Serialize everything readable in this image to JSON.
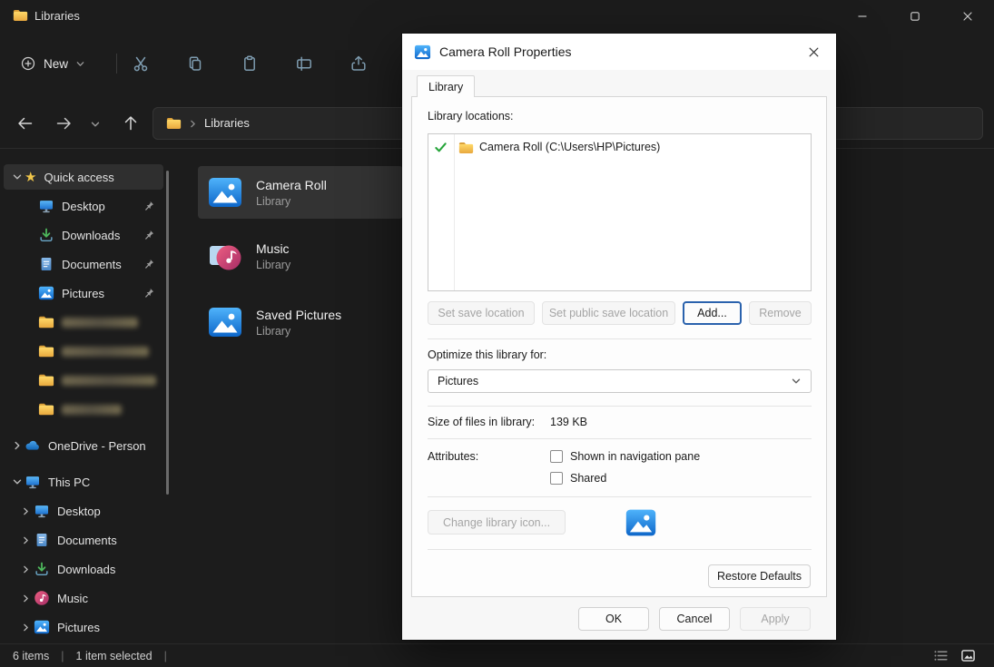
{
  "titlebar": {
    "title": "Libraries"
  },
  "toolbar": {
    "new_label": "New"
  },
  "navbar": {
    "breadcrumb_root": "Libraries"
  },
  "sidebar": {
    "quick_access": {
      "label": "Quick access",
      "items": [
        {
          "label": "Desktop"
        },
        {
          "label": "Downloads"
        },
        {
          "label": "Documents"
        },
        {
          "label": "Pictures"
        }
      ]
    },
    "onedrive_label": "OneDrive - Person",
    "this_pc": {
      "label": "This PC",
      "items": [
        {
          "label": "Desktop"
        },
        {
          "label": "Documents"
        },
        {
          "label": "Downloads"
        },
        {
          "label": "Music"
        },
        {
          "label": "Pictures"
        }
      ]
    }
  },
  "files": {
    "items": [
      {
        "name": "Camera Roll",
        "type": "Library"
      },
      {
        "name": "Music",
        "type": "Library"
      },
      {
        "name": "Saved Pictures",
        "type": "Library"
      }
    ]
  },
  "statusbar": {
    "count": "6 items",
    "divider": "|",
    "selected": "1 item selected"
  },
  "dialog": {
    "title": "Camera Roll Properties",
    "tab_label": "Library",
    "locations_label": "Library locations:",
    "location_name": "Camera Roll (C:\\Users\\HP\\Pictures)",
    "optimize_label": "Optimize this library for:",
    "optimize_value": "Pictures",
    "size_label": "Size of files in library:",
    "size_value": "139 KB",
    "attributes_label": "Attributes:",
    "attr_nav_pane": "Shown in navigation pane",
    "attr_shared": "Shared",
    "buttons": {
      "set_save": "Set save location",
      "set_public_save": "Set public save location",
      "add": "Add...",
      "remove": "Remove",
      "change_icon": "Change library icon...",
      "restore_defaults": "Restore Defaults",
      "ok": "OK",
      "cancel": "Cancel",
      "apply": "Apply"
    }
  }
}
